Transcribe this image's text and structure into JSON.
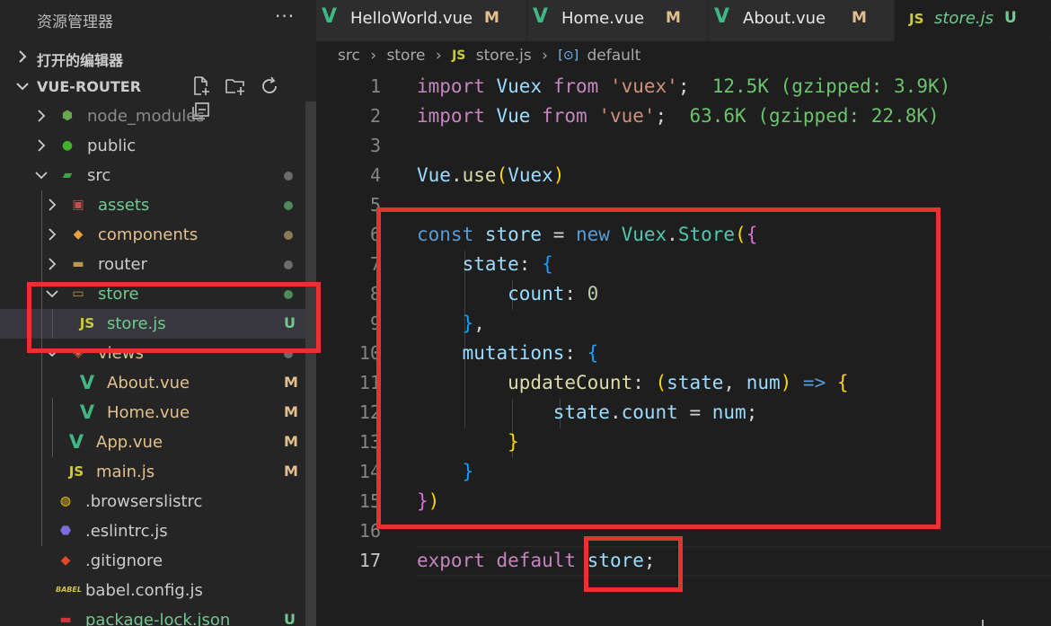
{
  "explorer": {
    "title": "资源管理器",
    "more": "···",
    "open_editors": "打开的编辑器",
    "root": "VUE-ROUTER"
  },
  "tree": [
    {
      "name": "node_modules",
      "color": "#8b8b8b",
      "icon": "node-folder-icon",
      "glyph": "⬢",
      "iconColor": "#6aa84f",
      "twist": "closed",
      "status": "",
      "statusColor": ""
    },
    {
      "name": "public",
      "color": "#cccccc",
      "icon": "public-folder-icon",
      "glyph": "●",
      "iconColor": "#43b02a",
      "twist": "closed",
      "status": "",
      "statusColor": ""
    },
    {
      "name": "src",
      "color": "#cccccc",
      "icon": "src-folder-icon",
      "glyph": "▰",
      "iconColor": "#43a047",
      "twist": "open",
      "status": "dot",
      "statusColor": "#6b6b6b"
    },
    {
      "name": "assets",
      "color": "#73c991",
      "icon": "assets-folder-icon",
      "glyph": "▣",
      "iconColor": "#c0504d",
      "twist": "closed",
      "status": "dot",
      "statusColor": "#4f8a5a"
    },
    {
      "name": "components",
      "color": "#e2c08d",
      "icon": "components-folder-icon",
      "glyph": "◆",
      "iconColor": "#e8a33d",
      "twist": "closed",
      "status": "dot",
      "statusColor": "#8a7a55"
    },
    {
      "name": "router",
      "color": "#cccccc",
      "icon": "folder-icon",
      "glyph": "▬",
      "iconColor": "#c09553",
      "twist": "closed",
      "status": "dot",
      "statusColor": "#6b6b6b"
    },
    {
      "name": "store",
      "color": "#73c991",
      "icon": "folder-open-icon",
      "glyph": "▭",
      "iconColor": "#c09553",
      "twist": "open",
      "status": "dot",
      "statusColor": "#4f8a5a"
    },
    {
      "name": "store.js",
      "color": "#73c991",
      "icon": "js-file-icon",
      "glyph": "JS",
      "iconColor": "#cbcb41",
      "twist": "",
      "status": "U",
      "statusColor": "#73c991"
    },
    {
      "name": "views",
      "color": "#e2c08d",
      "icon": "views-folder-icon",
      "glyph": "◈",
      "iconColor": "#e0623c",
      "twist": "open",
      "status": "dot",
      "statusColor": "#6b6b6b"
    },
    {
      "name": "About.vue",
      "color": "#e2c08d",
      "icon": "vue-file-icon",
      "glyph": "V",
      "iconColor": "#41b883",
      "twist": "",
      "status": "M",
      "statusColor": "#e2c08d"
    },
    {
      "name": "Home.vue",
      "color": "#e2c08d",
      "icon": "vue-file-icon",
      "glyph": "V",
      "iconColor": "#41b883",
      "twist": "",
      "status": "M",
      "statusColor": "#e2c08d"
    },
    {
      "name": "App.vue",
      "color": "#e2c08d",
      "icon": "vue-file-icon",
      "glyph": "V",
      "iconColor": "#41b883",
      "twist": "",
      "status": "M",
      "statusColor": "#e2c08d"
    },
    {
      "name": "main.js",
      "color": "#e2c08d",
      "icon": "js-file-icon",
      "glyph": "JS",
      "iconColor": "#cbcb41",
      "twist": "",
      "status": "M",
      "statusColor": "#e2c08d"
    },
    {
      "name": ".browserslistrc",
      "color": "#cccccc",
      "icon": "browserslist-icon",
      "glyph": "◍",
      "iconColor": "#f6c915",
      "twist": "",
      "status": "",
      "statusColor": ""
    },
    {
      "name": ".eslintrc.js",
      "color": "#cccccc",
      "icon": "eslint-icon",
      "glyph": "⬣",
      "iconColor": "#7b6fe0",
      "twist": "",
      "status": "",
      "statusColor": ""
    },
    {
      "name": ".gitignore",
      "color": "#cccccc",
      "icon": "git-icon",
      "glyph": "◆",
      "iconColor": "#e0492e",
      "twist": "",
      "status": "",
      "statusColor": ""
    },
    {
      "name": "babel.config.js",
      "color": "#cccccc",
      "icon": "babel-icon",
      "glyph": "BABEL",
      "iconColor": "#d4c34a",
      "twist": "",
      "status": "",
      "statusColor": ""
    },
    {
      "name": "package-lock.json",
      "color": "#73c991",
      "icon": "npm-icon",
      "glyph": "▬",
      "iconColor": "#cb3837",
      "twist": "",
      "status": "U",
      "statusColor": "#73c991"
    }
  ],
  "tabs": [
    {
      "label": "HelloWorld.vue",
      "mark": "M",
      "icon": "vue-file-icon",
      "glyph": "V",
      "iconColor": "#41b883",
      "active": false,
      "italic": false
    },
    {
      "label": "Home.vue",
      "mark": "M",
      "icon": "vue-file-icon",
      "glyph": "V",
      "iconColor": "#41b883",
      "active": false,
      "italic": false
    },
    {
      "label": "About.vue",
      "mark": "M",
      "icon": "vue-file-icon",
      "glyph": "V",
      "iconColor": "#41b883",
      "active": false,
      "italic": false
    },
    {
      "label": "store.js",
      "mark": "U",
      "icon": "js-file-icon",
      "glyph": "JS",
      "iconColor": "#cbcb41",
      "active": true,
      "italic": true
    }
  ],
  "breadcrumb": {
    "parts": [
      "src",
      "store",
      "store.js",
      "default"
    ],
    "js_glyph": "JS",
    "symbol_glyph": "[⊙]"
  },
  "editor": {
    "current_line": 17,
    "lines": [
      [
        [
          "import ",
          "kw2"
        ],
        [
          "Vuex ",
          "var"
        ],
        [
          "from ",
          "kw2"
        ],
        [
          "'vuex'",
          "str"
        ],
        [
          ";",
          ""
        ],
        [
          "  12.5K (gzipped: 3.9K)",
          "hint"
        ]
      ],
      [
        [
          "import ",
          "kw2"
        ],
        [
          "Vue ",
          "var"
        ],
        [
          "from ",
          "kw2"
        ],
        [
          "'vue'",
          "str"
        ],
        [
          ";",
          ""
        ],
        [
          "  63.6K (gzipped: 22.8K)",
          "hint"
        ]
      ],
      [],
      [
        [
          "Vue",
          "var"
        ],
        [
          ".",
          ""
        ],
        [
          "use",
          "fn"
        ],
        [
          "(",
          "b1"
        ],
        [
          "Vuex",
          "var"
        ],
        [
          ")",
          "b1"
        ]
      ],
      [],
      [
        [
          "const ",
          "kw"
        ],
        [
          "store ",
          "var"
        ],
        [
          "= ",
          ""
        ],
        [
          "new ",
          "kw"
        ],
        [
          "Vuex",
          "cls"
        ],
        [
          ".",
          ""
        ],
        [
          "Store",
          "cls"
        ],
        [
          "(",
          "b1"
        ],
        [
          "{",
          "b2"
        ]
      ],
      [
        [
          "    state",
          "var"
        ],
        [
          ": ",
          ""
        ],
        [
          "{",
          "b3"
        ]
      ],
      [
        [
          "        count",
          "var"
        ],
        [
          ": ",
          ""
        ],
        [
          "0",
          "num"
        ]
      ],
      [
        [
          "    ",
          ""
        ],
        [
          "}",
          "b3"
        ],
        [
          ",",
          ""
        ]
      ],
      [
        [
          "    mutations",
          "var"
        ],
        [
          ": ",
          ""
        ],
        [
          "{",
          "b3"
        ]
      ],
      [
        [
          "        updateCount",
          "fn"
        ],
        [
          ": ",
          ""
        ],
        [
          "(",
          "b1"
        ],
        [
          "state",
          "var"
        ],
        [
          ", ",
          ""
        ],
        [
          "num",
          "var"
        ],
        [
          ")",
          "b1"
        ],
        [
          " => ",
          "kw"
        ],
        [
          "{",
          "b1"
        ]
      ],
      [
        [
          "            state",
          "var"
        ],
        [
          ".",
          ""
        ],
        [
          "count",
          "var"
        ],
        [
          " = ",
          ""
        ],
        [
          "num",
          "var"
        ],
        [
          ";",
          ""
        ]
      ],
      [
        [
          "        ",
          ""
        ],
        [
          "}",
          "b1"
        ]
      ],
      [
        [
          "    ",
          ""
        ],
        [
          "}",
          "b3"
        ]
      ],
      [
        [
          "}",
          "b2"
        ],
        [
          ")",
          "b1"
        ]
      ],
      [],
      [
        [
          "export ",
          "kw2"
        ],
        [
          "default ",
          "kw2"
        ],
        [
          "store",
          "var"
        ],
        [
          ";",
          ""
        ]
      ]
    ]
  },
  "colors": {
    "highlight_box": "#e8322f",
    "added": "#73c991",
    "modified": "#e2c08d"
  }
}
